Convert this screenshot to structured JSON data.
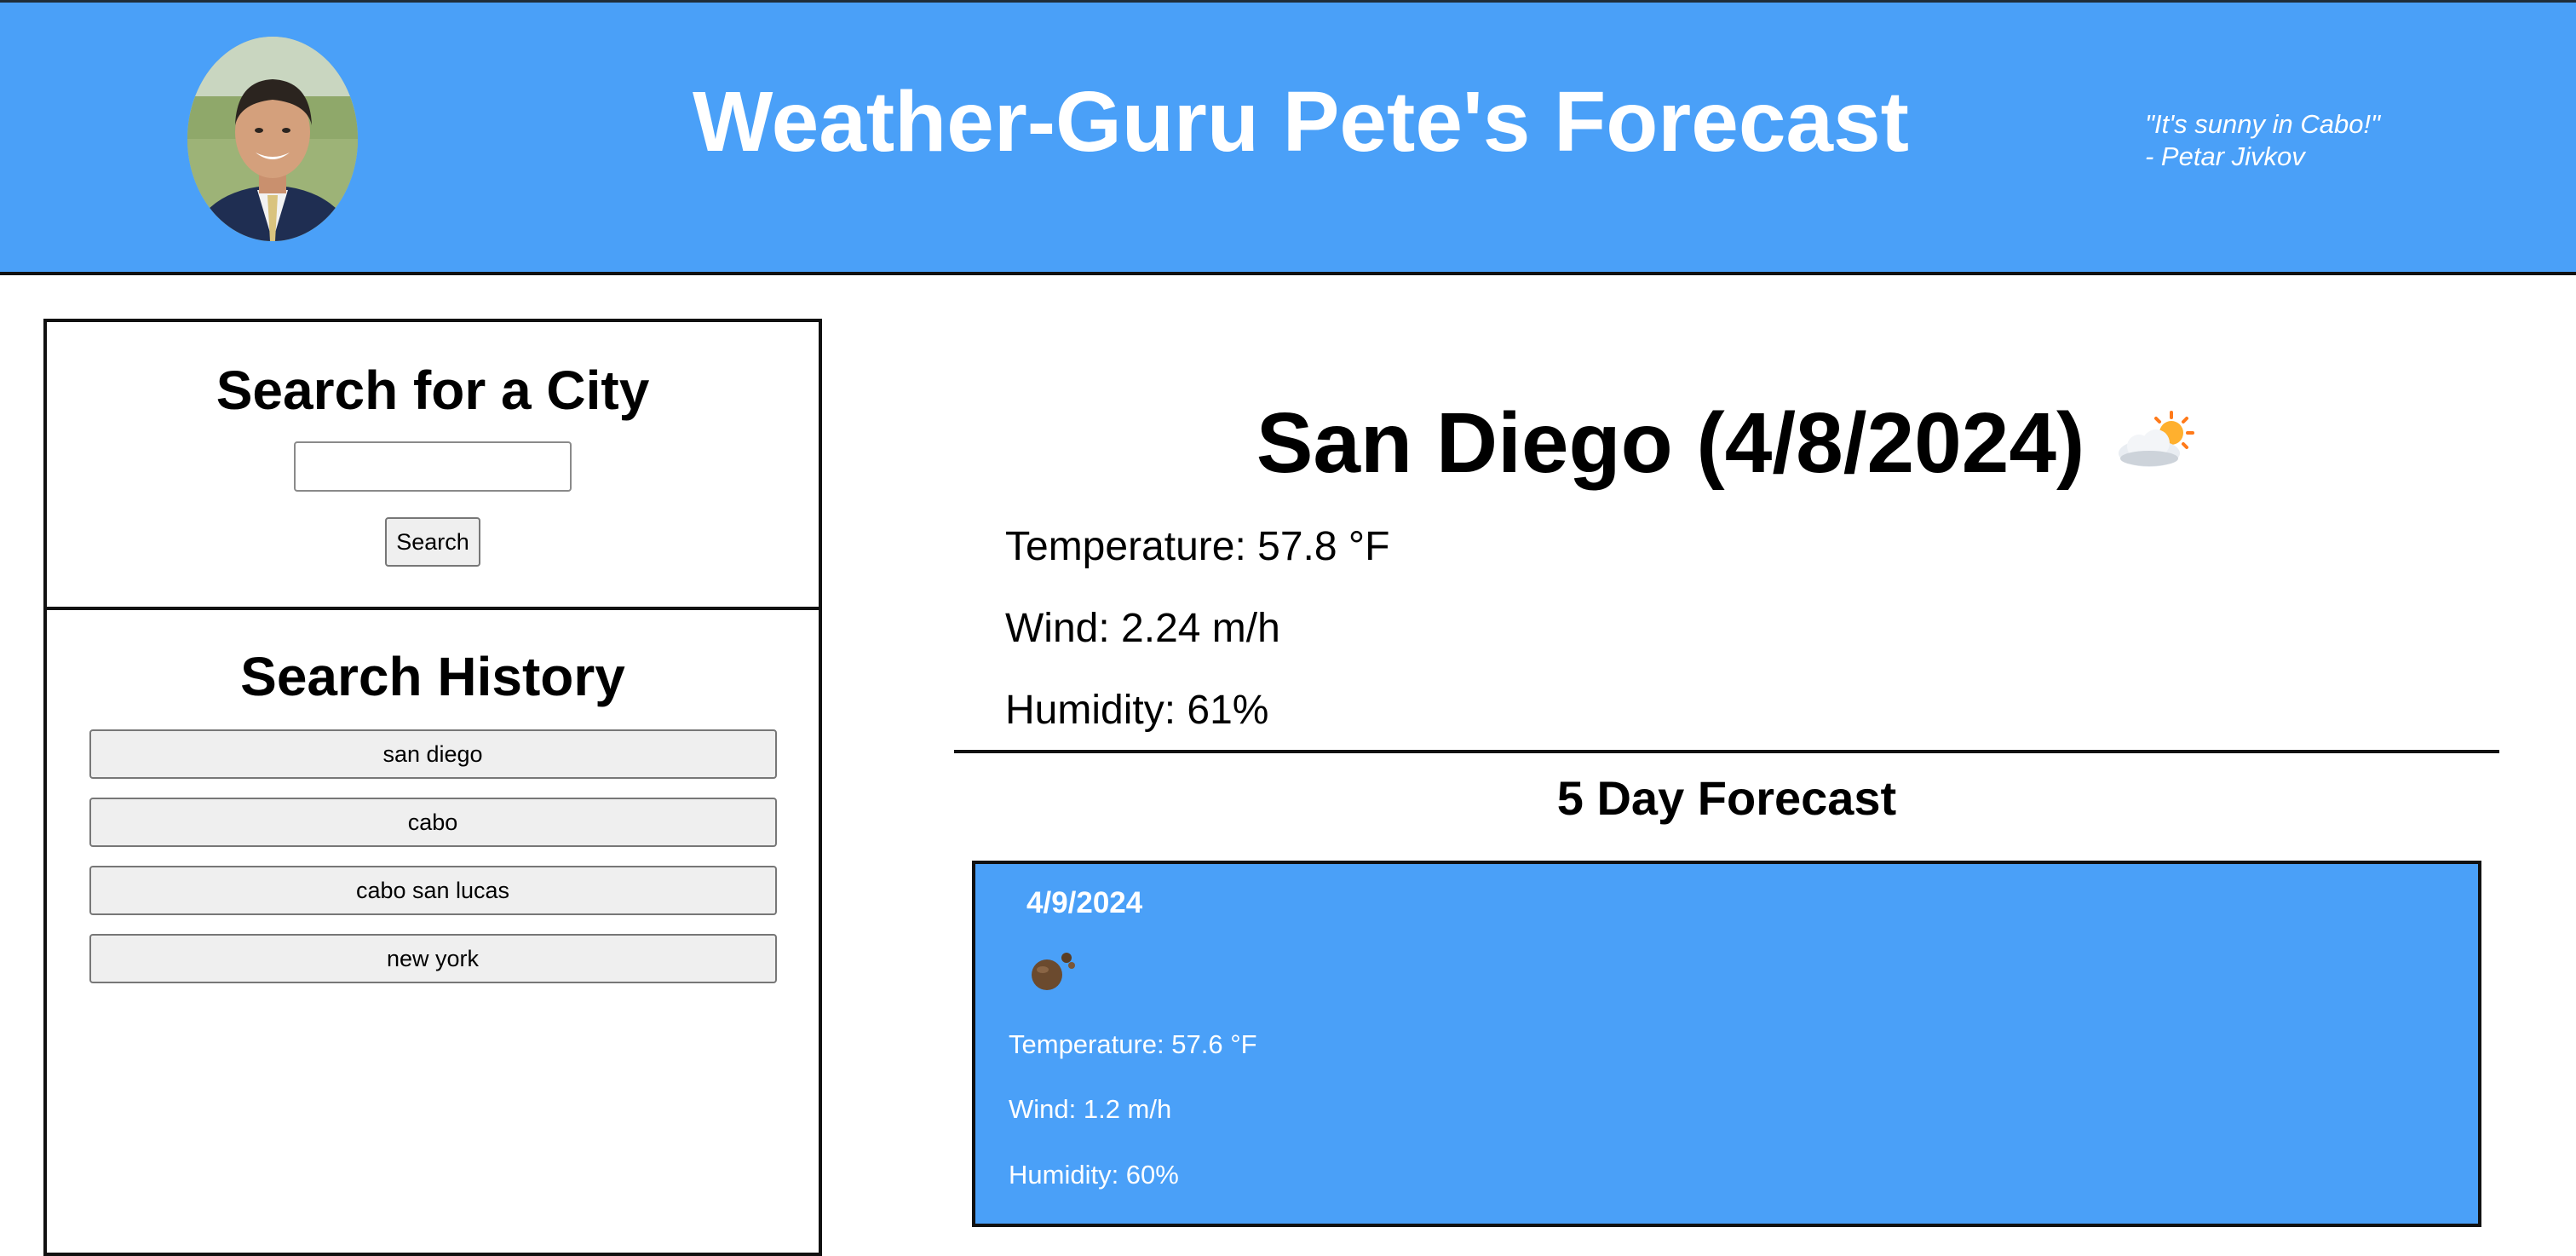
{
  "header": {
    "title": "Weather-Guru Pete's Forecast",
    "quote_line1": "\"It's sunny in Cabo!\"",
    "quote_line2": "- Petar Jivkov",
    "color": "#4aa0f8"
  },
  "search": {
    "heading": "Search for a City",
    "input_value": "",
    "button_label": "Search"
  },
  "history": {
    "heading": "Search History",
    "items": [
      {
        "label": "san diego"
      },
      {
        "label": "cabo"
      },
      {
        "label": "cabo san lucas"
      },
      {
        "label": "new york"
      }
    ]
  },
  "current": {
    "title": "San Diego (4/8/2024)",
    "icon": "partly-cloudy-icon",
    "temperature": "Temperature: 57.8 °F",
    "wind": "Wind: 2.24 m/h",
    "humidity": "Humidity: 61%"
  },
  "forecast": {
    "heading": "5 Day Forecast",
    "days": [
      {
        "date": "4/9/2024",
        "icon": "broken-clouds-icon",
        "temperature": "Temperature: 57.6 °F",
        "wind": "Wind: 1.2 m/h",
        "humidity": "Humidity: 60%"
      }
    ]
  }
}
